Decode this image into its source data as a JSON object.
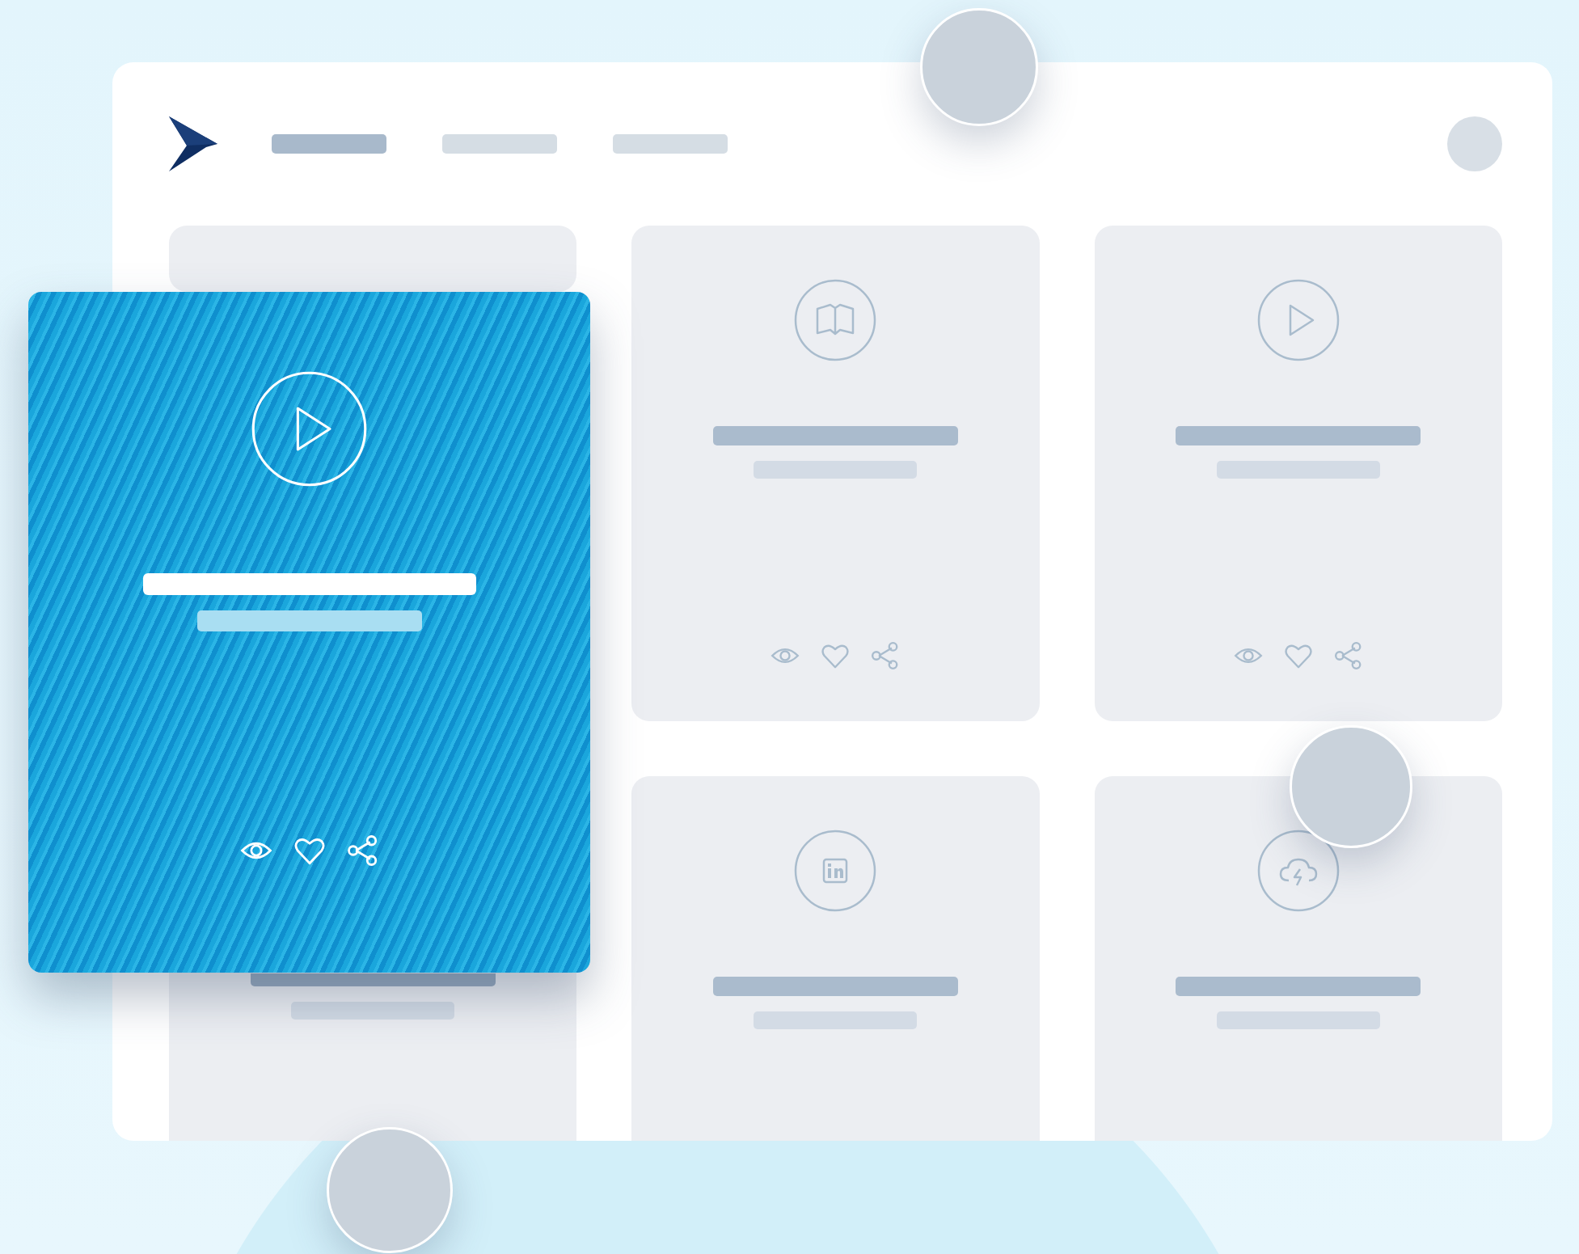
{
  "nav": {
    "items": [
      {
        "selected": true
      },
      {
        "selected": false
      },
      {
        "selected": false
      }
    ]
  },
  "cards": [
    {
      "kind": "empty"
    },
    {
      "kind": "book",
      "actions": true
    },
    {
      "kind": "play",
      "actions": true
    },
    {
      "kind": "empty"
    },
    {
      "kind": "linkedin"
    },
    {
      "kind": "cloud"
    }
  ],
  "featured_card": {
    "kind": "play",
    "actions": true
  }
}
